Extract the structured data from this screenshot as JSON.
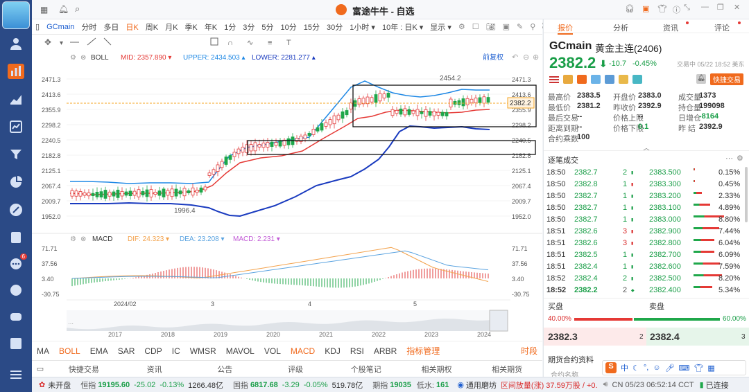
{
  "window": {
    "title": "富途牛牛 - 自选"
  },
  "toolbar": {
    "symbol": "GCmain",
    "periods": [
      "分时",
      "多日",
      "日K",
      "周K",
      "月K",
      "季K",
      "年K",
      "1分",
      "3分",
      "5分",
      "10分",
      "15分",
      "30分",
      "1小时 ▾",
      "10年 : 日K ▾",
      "显示 ▾"
    ],
    "active_period": "日K"
  },
  "chart": {
    "boll": {
      "name": "BOLL",
      "mid_label": "MID: 2357.890 ▾",
      "upper_label": "UPPER: 2434.503 ▴",
      "lower_label": "LOWER: 2281.277 ▴",
      "adjust": "前复权"
    },
    "y_ticks": [
      "2471.3",
      "2413.6",
      "2355.9",
      "2298.2",
      "2240.5",
      "2182.8",
      "2125.1",
      "2067.4",
      "2009.7",
      "1952.0"
    ],
    "current_price_tag": "2382.2",
    "annotations": {
      "high": "2454.2",
      "low": "1996.4"
    },
    "macd": {
      "name": "MACD",
      "dif_label": "DIF: 24.323 ▾",
      "dea_label": "DEA: 23.208 ▾",
      "macd_label": "MACD: 2.231 ▾",
      "ticks": [
        "71.71",
        "37.56",
        "3.40",
        "-30.75"
      ]
    },
    "x_labels": [
      "2024/02",
      "3",
      "4",
      "5"
    ],
    "overview_years": [
      "2017",
      "2018",
      "2019",
      "2020",
      "2021",
      "2022",
      "2023",
      "2024"
    ],
    "colors": {
      "up": "#e23b3b",
      "down": "#1fa74a",
      "upper": "#1e88e5",
      "mid": "#e53935",
      "lower": "#1a3bbf",
      "dif": "#f3a24c",
      "dea": "#5aa3e0"
    }
  },
  "indicators": [
    "MA",
    "BOLL",
    "EMA",
    "SAR",
    "CDP",
    "IC",
    "WMSR",
    "MAVOL",
    "VOL",
    "MACD",
    "KDJ",
    "RSI",
    "ARBR",
    "指标管理"
  ],
  "indicators_active": [
    "BOLL",
    "MACD"
  ],
  "indicators_right": "时段",
  "bottom_tabs": [
    "快捷交易",
    "资讯",
    "公告",
    "评级",
    "个股笔记",
    "相关期权",
    "相关期货"
  ],
  "right": {
    "tabs": [
      "报价",
      "分析",
      "资讯",
      "评论"
    ],
    "symbol": "GCmain",
    "name": "黄金主连(2406)",
    "price": "2382.2",
    "change": "-10.7",
    "change_pct": "-0.45%",
    "trade_status": "交易中 05/22 18:52 美东",
    "quick_trade": "快捷交易",
    "stats": [
      [
        "最高价",
        "2383.5",
        "开盘价",
        "2383.0",
        "成交量",
        "1373"
      ],
      [
        "最低价",
        "2381.2",
        "昨收价",
        "2392.9",
        "持仓量",
        "199098"
      ],
      [
        "最后交易",
        "--",
        "价格上限",
        "--",
        "日增仓",
        "-8164"
      ],
      [
        "距离到期",
        "--",
        "价格下限",
        "0.1",
        "昨  结",
        "2392.9"
      ],
      [
        "合约乘数",
        "100",
        "",
        "",
        "",
        ""
      ]
    ],
    "ticks_title": "逐笔成交",
    "ticks": [
      [
        "18:50",
        "2382.7",
        "2",
        "2383.500",
        "0.15%"
      ],
      [
        "18:50",
        "2382.8",
        "1",
        "2383.300",
        "0.45%"
      ],
      [
        "18:50",
        "2382.7",
        "1",
        "2383.200",
        "2.33%"
      ],
      [
        "18:50",
        "2382.7",
        "1",
        "2383.100",
        "4.89%"
      ],
      [
        "18:50",
        "2382.7",
        "1",
        "2383.000",
        "8.80%"
      ],
      [
        "18:51",
        "2382.6",
        "3",
        "2382.900",
        "7.44%"
      ],
      [
        "18:51",
        "2382.6",
        "3",
        "2382.800",
        "6.04%"
      ],
      [
        "18:51",
        "2382.5",
        "1",
        "2382.700",
        "6.09%"
      ],
      [
        "18:51",
        "2382.4",
        "1",
        "2382.600",
        "7.59%"
      ],
      [
        "18:52",
        "2382.4",
        "2",
        "2382.500",
        "8.20%"
      ],
      [
        "18:52",
        "2382.2",
        "2",
        "2382.400",
        "5.34%"
      ]
    ],
    "bid_label": "买盘",
    "ask_label": "卖盘",
    "bid_pct": "40.00%",
    "ask_pct": "60.00%",
    "bid": "2382.3",
    "bid_qty": "2",
    "ask": "2382.4",
    "ask_qty": "3",
    "contract_info": "期货合约资料",
    "contract_sub": "合约名称"
  },
  "status": {
    "market": "未开盘",
    "hsi_label": "恒指",
    "hsi": "19195.60",
    "hsi_chg": "-25.02",
    "hsi_pct": "-0.13%",
    "hsi_vol": "1266.48亿",
    "gq_label": "国指",
    "gq": "6817.68",
    "gq_chg": "-3.29",
    "gq_pct": "-0.05%",
    "gq_vol": "519.78亿",
    "fut_label": "期指",
    "fut": "19035",
    "low_label": "低水:",
    "low": "161",
    "news_source": "通用磨坊",
    "news": "区间放量(涨) 37.59万股 / +0.",
    "clock": "CN 05/23 06:52:14 CCT",
    "connect": "已连接"
  }
}
